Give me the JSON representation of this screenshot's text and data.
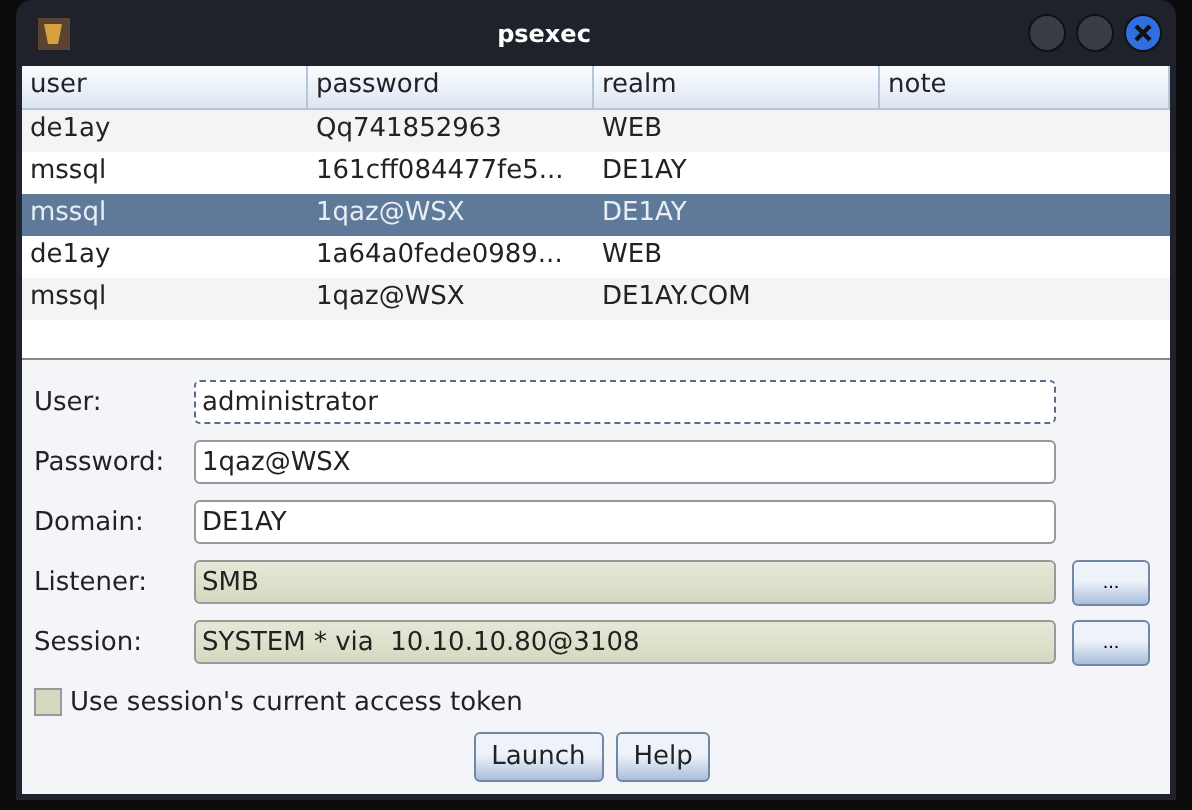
{
  "window": {
    "title": "psexec"
  },
  "table": {
    "columns": [
      "user",
      "password",
      "realm",
      "note"
    ],
    "rows": [
      {
        "cells": [
          "de1ay",
          "Qq741852963",
          "WEB",
          ""
        ],
        "selected": false
      },
      {
        "cells": [
          "mssql",
          "161cff084477fe5...",
          "DE1AY",
          ""
        ],
        "selected": false
      },
      {
        "cells": [
          "mssql",
          "1qaz@WSX",
          "DE1AY",
          ""
        ],
        "selected": true
      },
      {
        "cells": [
          "de1ay",
          "1a64a0fede0989...",
          "WEB",
          ""
        ],
        "selected": false
      },
      {
        "cells": [
          "mssql",
          "1qaz@WSX",
          "DE1AY.COM",
          ""
        ],
        "selected": false
      }
    ]
  },
  "form": [
    {
      "label": "User:",
      "value": "administrator",
      "kind": "text",
      "focused": true
    },
    {
      "label": "Password:",
      "value": "1qaz@WSX",
      "kind": "text",
      "focused": false
    },
    {
      "label": "Domain:",
      "value": "DE1AY",
      "kind": "text",
      "focused": false
    },
    {
      "label": "Listener:",
      "value": "SMB",
      "kind": "picker",
      "button": "...",
      "focused": false
    },
    {
      "label": "Session:",
      "value": "SYSTEM * via  10.10.10.80@3108",
      "kind": "picker",
      "button": "...",
      "focused": false
    }
  ],
  "checkbox": {
    "label": "Use session's current access token",
    "checked": false
  },
  "buttons": [
    "Launch",
    "Help"
  ]
}
